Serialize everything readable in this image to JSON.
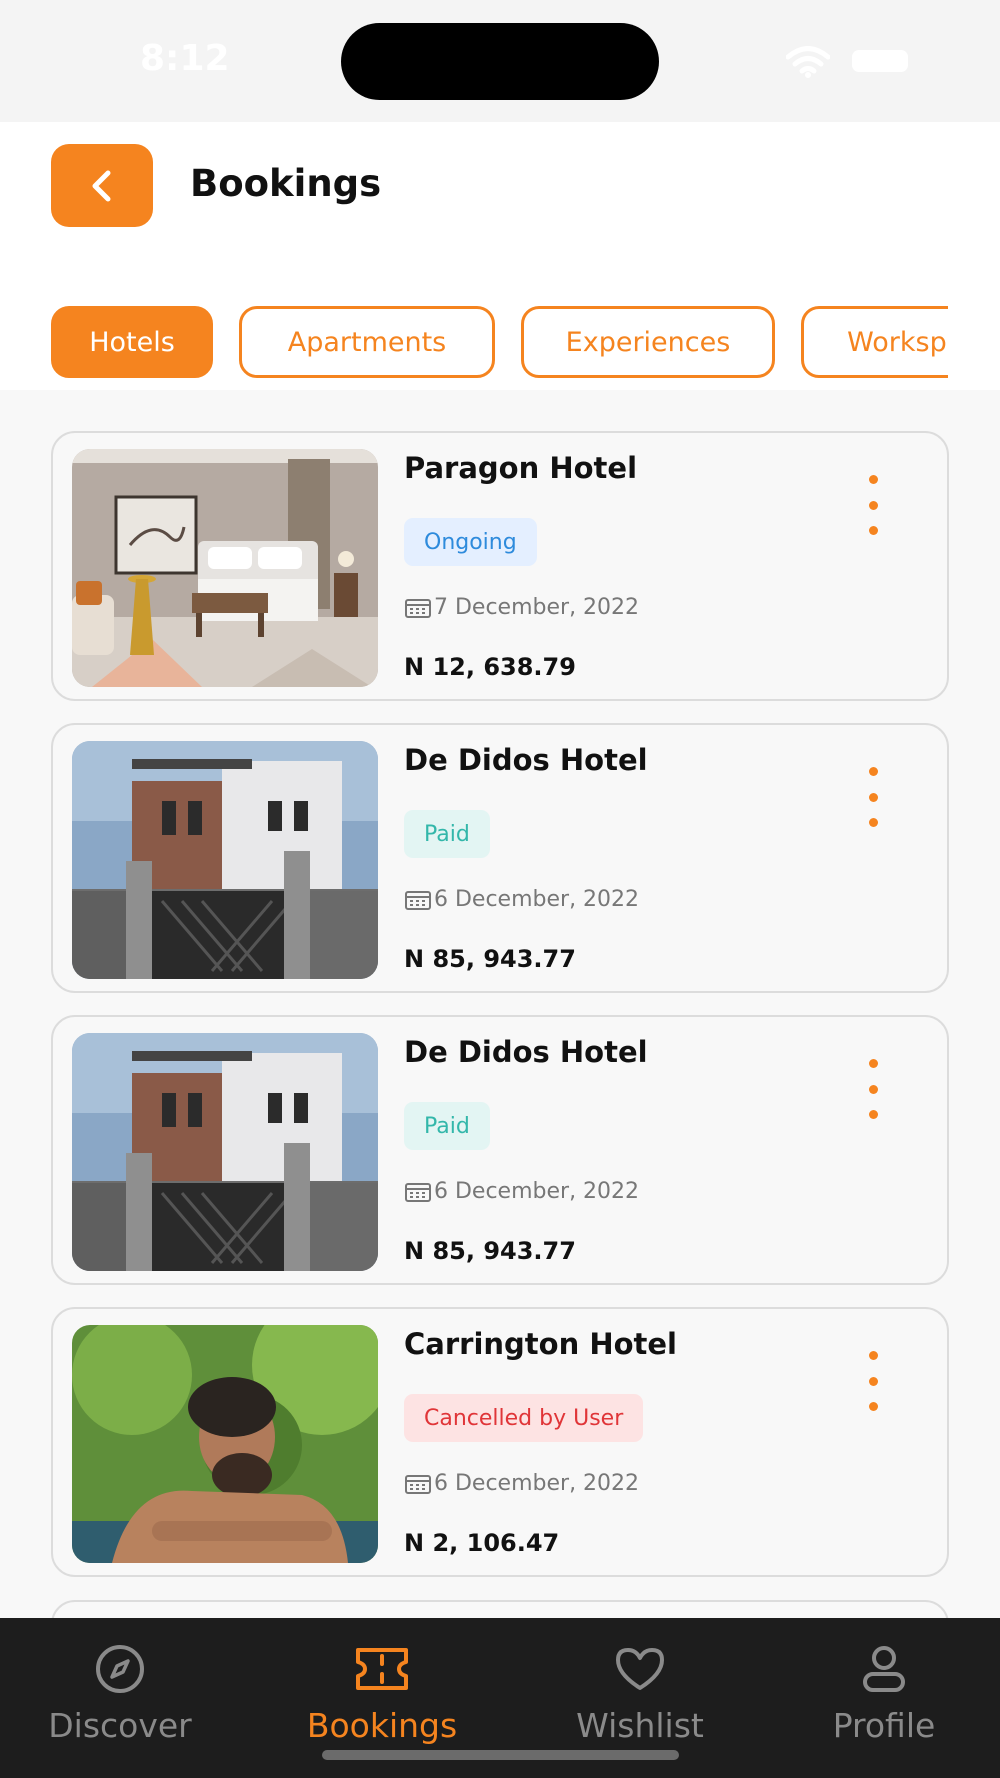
{
  "status_bar": {
    "time": "8:12"
  },
  "header": {
    "title": "Bookings"
  },
  "tabs": [
    {
      "label": "Hotels",
      "active": true
    },
    {
      "label": "Apartments",
      "active": false
    },
    {
      "label": "Experiences",
      "active": false
    },
    {
      "label": "Workspaces",
      "active": false
    }
  ],
  "bookings": [
    {
      "name": "Paragon Hotel",
      "status": "Ongoing",
      "date": "7 December, 2022",
      "price": "N 12, 638.79",
      "image": "hotel-bedroom"
    },
    {
      "name": "De Didos Hotel",
      "status": "Paid",
      "date": "6 December, 2022",
      "price": "N 85, 943.77",
      "image": "building-exterior"
    },
    {
      "name": "De Didos Hotel",
      "status": "Paid",
      "date": "6 December, 2022",
      "price": "N 85, 943.77",
      "image": "building-exterior"
    },
    {
      "name": "Carrington Hotel",
      "status": "Cancelled by User",
      "date": "6 December, 2022",
      "price": "N 2, 106.47",
      "image": "man-in-pool"
    }
  ],
  "bottom_nav": [
    {
      "label": "Discover",
      "icon": "compass-icon",
      "active": false
    },
    {
      "label": "Bookings",
      "icon": "ticket-icon",
      "active": true
    },
    {
      "label": "Wishlist",
      "icon": "heart-icon",
      "active": false
    },
    {
      "label": "Profile",
      "icon": "user-icon",
      "active": false
    }
  ],
  "colors": {
    "accent": "#f5841f",
    "ongoing": "#2e8bdc",
    "paid": "#33b7aa",
    "cancelled": "#e03538",
    "nav_bg": "#1d1d1d"
  }
}
